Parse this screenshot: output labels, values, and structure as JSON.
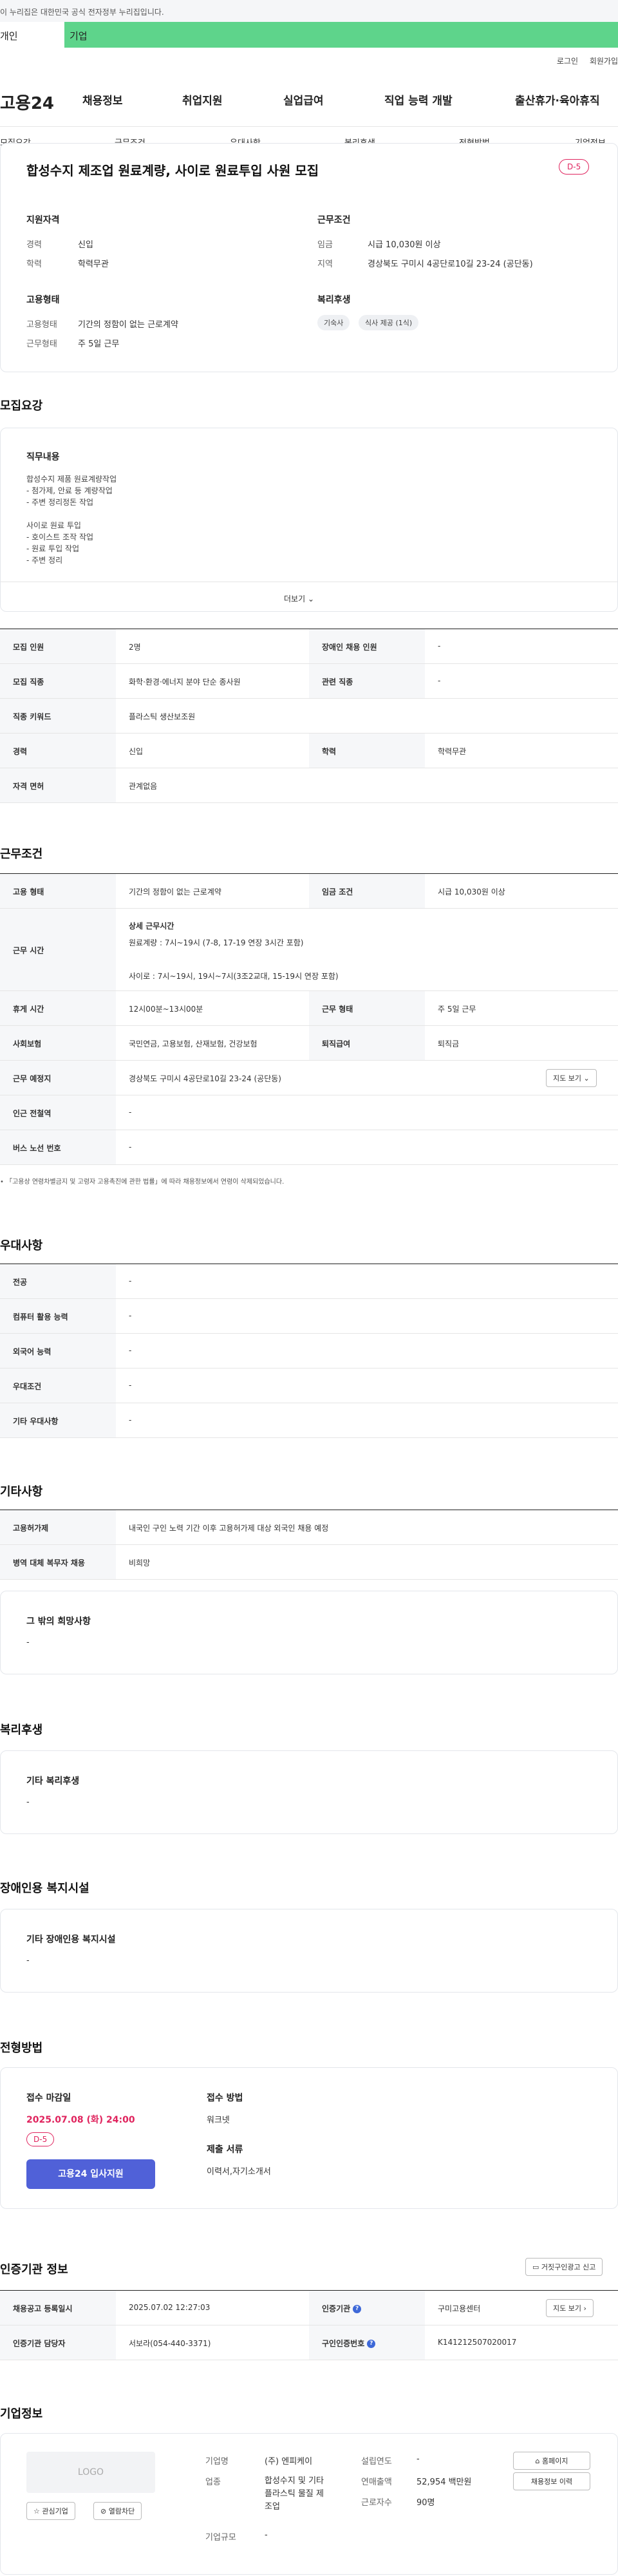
{
  "gov_banner": "이 누리집은 대한민국 공식 전자정부 누리집입니다.",
  "tabs": {
    "personal": "개인",
    "corporate": "기업"
  },
  "util_links": {
    "login": "로그인",
    "signup": "회원가입"
  },
  "logo": "고용24",
  "gnb": [
    "채용정보",
    "취업지원",
    "실업급여",
    "직업 능력 개발",
    "출산휴가·육아휴직"
  ],
  "subnav": [
    "모집요강",
    "근무조건",
    "우대사항",
    "복리후생",
    "전형방법",
    "기업정보"
  ],
  "summary": {
    "title": "합성수지 제조업 원료계량, 사이로 원료투입 사원 모집",
    "dday": "D-5",
    "qual_h": "지원자격",
    "qual": [
      {
        "k": "경력",
        "v": "신입"
      },
      {
        "k": "학력",
        "v": "학력무관"
      }
    ],
    "work_h": "근무조건",
    "work": [
      {
        "k": "임금",
        "v": "시급 10,030원 이상"
      },
      {
        "k": "지역",
        "v": "경상북도 구미시 4공단로10길 23-24 (공단동)"
      }
    ],
    "emp_h": "고용형태",
    "emp": [
      {
        "k": "고용형태",
        "v": "기간의 정함이 없는 근로계약"
      },
      {
        "k": "근무형태",
        "v": "주 5일 근무"
      }
    ],
    "welfare_h": "복리후생",
    "welfare_chips": [
      "기숙사",
      "식사 제공 (1식)"
    ]
  },
  "recruit": {
    "heading": "모집요강",
    "duty_h": "직무내용",
    "duty_lines": [
      "합성수지 제품 원료계량작업",
      "- 첨가제, 안료 등 계량작업",
      "- 주변 정리정돈 작업",
      "",
      "사이로 원료 투입",
      "- 호이스트 조작 작업",
      "- 원료 투입 작업",
      "- 주변 정리"
    ],
    "more": "더보기",
    "rows": [
      {
        "k1": "모집 인원",
        "v1": "2명",
        "k2": "장애인 채용 인원",
        "v2": "-"
      },
      {
        "k1": "모집 직종",
        "v1": "화학·환경·에너지 분야 단순 종사원",
        "k2": "관련 직종",
        "v2": "-"
      },
      {
        "k1": "직종 키워드",
        "v1": "플라스틱 생산보조원"
      },
      {
        "k1": "경력",
        "v1": "신입",
        "k2": "학력",
        "v2": "학력무관"
      },
      {
        "k1": "자격 면허",
        "v1": "관계없음"
      }
    ]
  },
  "conditions": {
    "heading": "근무조건",
    "emp_type_k": "고용 형태",
    "emp_type_v": "기간의 정함이 없는 근로계약",
    "wage_k": "임금 조건",
    "wage_v": "시급 10,030원 이상",
    "hours_k": "근무 시간",
    "hours_title": "상세 근무시간",
    "hours_l1": "원료계량 : 7시~19시 (7-8, 17-19 연장 3시간 포함)",
    "hours_l2": "사이로 : 7시~19시, 19시~7시(3조2교대, 15-19시 연장 포함)",
    "break_k": "휴게 시간",
    "break_v": "12시00분~13시00분",
    "shift_k": "근무 형태",
    "shift_v": "주 5일 근무",
    "ins_k": "사회보험",
    "ins_v": "국민연금, 고용보험, 산재보험, 건강보험",
    "sev_k": "퇴직급여",
    "sev_v": "퇴직금",
    "place_k": "근무 예정지",
    "place_v": "경상북도 구미시 4공단로10길 23-24 (공단동)",
    "map_btn": "지도 보기",
    "station_k": "인근 전철역",
    "station_v": "-",
    "bus_k": "버스 노선 번호",
    "bus_v": "-",
    "note": "「고용상 연령차별금지 및 고령자 고용촉진에 관한 법률」에 따라 채용정보에서 연령이 삭제되었습니다."
  },
  "pref": {
    "heading": "우대사항",
    "rows": [
      {
        "k": "전공",
        "v": "-"
      },
      {
        "k": "컴퓨터 활용 능력",
        "v": "-"
      },
      {
        "k": "외국어 능력",
        "v": "-"
      },
      {
        "k": "우대조건",
        "v": "-"
      },
      {
        "k": "기타 우대사항",
        "v": "-"
      }
    ]
  },
  "etc": {
    "heading": "기타사항",
    "rows": [
      {
        "k": "고용허가제",
        "v": "내국인 구인 노력 기간 이후 고용허가제 대상 외국인 채용 예정"
      },
      {
        "k": "병역 대체 복무자 채용",
        "v": "비희망"
      }
    ],
    "other_h": "그 밖의 희망사항",
    "other_v": "-"
  },
  "welfare": {
    "heading": "복리후생",
    "box_h": "기타 복리후생",
    "box_v": "-"
  },
  "disab": {
    "heading": "장애인용 복지시설",
    "box_h": "기타 장애인용 복지시설",
    "box_v": "-"
  },
  "screening": {
    "heading": "전형방법",
    "deadline_h": "접수 마감일",
    "deadline_v": "2025.07.08 (화) 24:00",
    "dday": "D-5",
    "apply": "고용24 입사지원",
    "method_h": "접수 방법",
    "method_v": "워크넷",
    "docs_h": "제출 서류",
    "docs_v": "이력서,자기소개서"
  },
  "agency": {
    "heading": "인증기관 정보",
    "report_btn": "거짓구인광고 신고",
    "reg_k": "채용공고 등록일시",
    "reg_v": "2025.07.02 12:27:03",
    "org_k": "인증기관",
    "org_v": "구미고용센터",
    "mgr_k": "인증기관 담당자",
    "mgr_v": "서보라(054-440-3371)",
    "id_k": "구인인증번호",
    "id_v": "K141212507020017",
    "map_btn": "지도 보기"
  },
  "company": {
    "heading": "기업정보",
    "logo_text": "LOGO",
    "fav_btn": "관심기업",
    "block_btn": "열람차단",
    "name_k": "기업명",
    "name_v": "(주) 엔피케이",
    "ind_k": "업종",
    "ind_v": [
      "합성수지 및 기타",
      "플라스틱 물질 제",
      "조업"
    ],
    "founded_k": "설립연도",
    "founded_v": "-",
    "sales_k": "연매출액",
    "sales_v": "52,954 백만원",
    "staff_k": "근로자수",
    "staff_v": "90명",
    "size_k": "기업규모",
    "size_v": "-",
    "home_btn": "홈페이지",
    "jobs_btn": "채용정보 이력"
  }
}
